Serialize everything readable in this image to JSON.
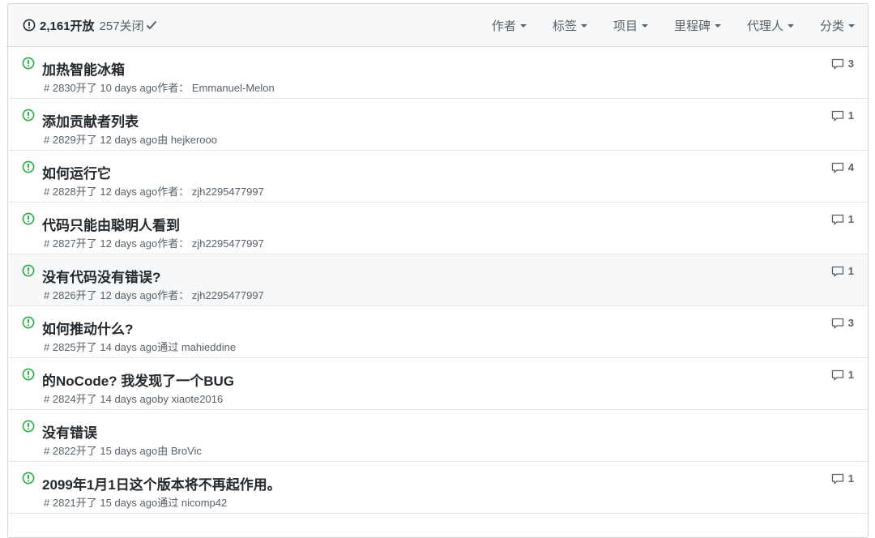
{
  "header": {
    "open_label": "2,161开放",
    "closed_label": "257关闭",
    "filters": [
      "作者",
      "标签",
      "项目",
      "里程碑",
      "代理人",
      "分类"
    ]
  },
  "issues": [
    {
      "title": "加热智能冰箱",
      "number": "# 2830",
      "opened": "开了 10 days ago",
      "by": "作者：",
      "author": "Emmanuel-Melon",
      "comments": "3"
    },
    {
      "title": "添加贡献者列表",
      "number": "# 2829",
      "opened": "开了 12 days ago",
      "by": "由",
      "author": "hejkerooo",
      "comments": "1"
    },
    {
      "title": "如何运行它",
      "number": "# 2828",
      "opened": "开了 12 days ago",
      "by": "作者：",
      "author": "zjh2295477997",
      "comments": "4"
    },
    {
      "title": "代码只能由聪明人看到",
      "number": "# 2827",
      "opened": "开了 12 days ago",
      "by": "作者：",
      "author": "zjh2295477997",
      "comments": "1"
    },
    {
      "title": "没有代码没有错误?",
      "number": "# 2826",
      "opened": "开了 12 days ago",
      "by": "作者：",
      "author": "zjh2295477997",
      "comments": "1"
    },
    {
      "title": "如何推动什么?",
      "number": "# 2825",
      "opened": "开了 14 days ago",
      "by": "通过",
      "author": "mahieddine",
      "comments": "3"
    },
    {
      "title": "的NoCode? 我发现了一个BUG",
      "number": "# 2824",
      "opened": "开了 14 days ago",
      "by": "by",
      "author": "xiaote2016",
      "comments": "1"
    },
    {
      "title": "没有错误",
      "number": "# 2822",
      "opened": "开了 15 days ago",
      "by": "由",
      "author": "BroVic",
      "comments": ""
    },
    {
      "title": "2099年1月1日这个版本将不再起作用。",
      "number": "# 2821",
      "opened": "开了 15 days ago",
      "by": "通过",
      "author": "nicomp42",
      "comments": "1"
    }
  ],
  "colors": {
    "open_icon": "#28a745",
    "header_bg": "#f6f8fa",
    "border": "#d1d5da",
    "muted": "#586069"
  },
  "icons": {
    "issue": "issue-opened-icon",
    "comment": "comment-icon",
    "check": "check-icon",
    "caret": "caret-down-icon"
  }
}
